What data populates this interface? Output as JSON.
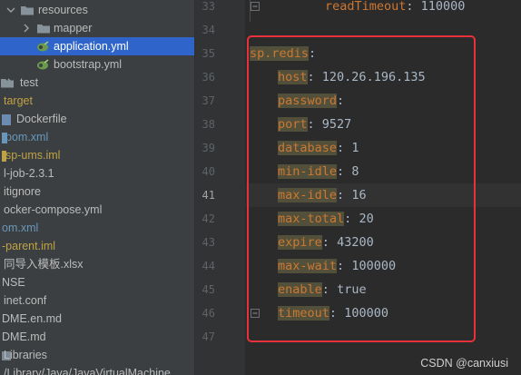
{
  "project_tree": {
    "items": [
      {
        "label": "resources",
        "color": "gray"
      },
      {
        "label": "mapper",
        "color": "gray"
      },
      {
        "label": "application.yml",
        "color": "white",
        "selected": true
      },
      {
        "label": "bootstrap.yml",
        "color": "gray"
      },
      {
        "label": "test",
        "color": "gray"
      },
      {
        "label": "target",
        "color": "yellow"
      },
      {
        "label": "Dockerfile",
        "color": "gray"
      },
      {
        "label": "pom.xml",
        "color": "blue"
      },
      {
        "label": "sp-ums.iml",
        "color": "yellow"
      },
      {
        "label": "l-job-2.3.1",
        "color": "gray"
      },
      {
        "label": "itignore",
        "color": "gray"
      },
      {
        "label": "ocker-compose.yml",
        "color": "gray"
      },
      {
        "label": "om.xml",
        "color": "blue"
      },
      {
        "label": "-parent.iml",
        "color": "yellow"
      },
      {
        "label": "同导入模板.xlsx",
        "color": "gray"
      },
      {
        "label": "NSE",
        "color": "gray"
      },
      {
        "label": "inet.conf",
        "color": "gray"
      },
      {
        "label": "DME.en.md",
        "color": "gray"
      },
      {
        "label": "DME.md",
        "color": "gray"
      },
      {
        "label": "Libraries",
        "color": "gray"
      },
      {
        "label": "/Library/Java/JavaVirtualMachine",
        "color": "gray"
      }
    ]
  },
  "editor": {
    "line_numbers": [
      "33",
      "34",
      "35",
      "36",
      "37",
      "38",
      "39",
      "40",
      "41",
      "42",
      "43",
      "44",
      "45",
      "46",
      "47"
    ],
    "current_line": "41",
    "top_fragment": {
      "key": "readTimeout",
      "sep": ": ",
      "value": "110000"
    },
    "section_key": "sp.redis",
    "entries": [
      {
        "key": "host",
        "value": "120.26.196.135"
      },
      {
        "key": "password",
        "value": ""
      },
      {
        "key": "port",
        "value": "9527"
      },
      {
        "key": "database",
        "value": "1"
      },
      {
        "key": "min-idle",
        "value": "8"
      },
      {
        "key": "max-idle",
        "value": "16"
      },
      {
        "key": "max-total",
        "value": "20"
      },
      {
        "key": "expire",
        "value": "43200"
      },
      {
        "key": "max-wait",
        "value": "100000"
      },
      {
        "key": "enable",
        "value": "true"
      },
      {
        "key": "timeout",
        "value": "100000"
      }
    ]
  },
  "watermark": "CSDN @canxiusi",
  "colors": {
    "key": "#cc7832",
    "key_highlight_bg": "#52503a",
    "value": "#a9b7c6",
    "selection": "#2f65ca",
    "annotation_box": "#e8313a"
  }
}
